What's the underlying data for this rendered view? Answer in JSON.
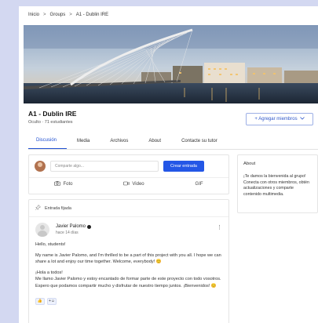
{
  "breadcrumb": {
    "items": [
      "Inicio",
      "Groups",
      "A1 - Dublin IRE"
    ],
    "separator": ">"
  },
  "group": {
    "name": "A1 - Dublin IRE",
    "subtitle": "Oculto · 71 estudiantes",
    "join_button": "+ Agregar miembros"
  },
  "tabs": [
    "Discusión",
    "Media",
    "Archivos",
    "About",
    "Contacte su tutor"
  ],
  "composer": {
    "placeholder": "Comparte algo...",
    "create_button": "Crear entrada",
    "actions": [
      "Foto",
      "Video",
      "GIF"
    ]
  },
  "post": {
    "pinned_label": "Entrada fijada",
    "author": "Javier Palomo",
    "time": "hace 14 días",
    "paragraphs": [
      "Hello, students!",
      "My name is Javier Palomo, and I'm thrilled to be a part of this project with you all. I hope we can share a lot and enjoy our time together. Welcome, everybody! 😊",
      "¡Hola a todos!",
      "Me llamo Javier Palomo y estoy encantado de formar parte de este proyecto con todo vosotros. Espero que podamos compartir mucho y disfrutar de nuestro tiempo juntos. ¡Bienvenidos! 😊"
    ],
    "reactions": [
      "👍",
      "+☺"
    ]
  },
  "about": {
    "title": "About",
    "text": "¡Te damos la bienvenida al grupo! Conecta con otros miembros, obtén actualizaciones y comparte contenido multimedia."
  },
  "colors": {
    "accent": "#2457e6",
    "outer_background": "#d3d8f1"
  },
  "icons": {
    "join": "plus-icon",
    "chevron": "chevron-down-icon",
    "pin": "pin-icon",
    "photo": "camera-icon",
    "video": "video-icon",
    "menu": "kebab-icon"
  }
}
